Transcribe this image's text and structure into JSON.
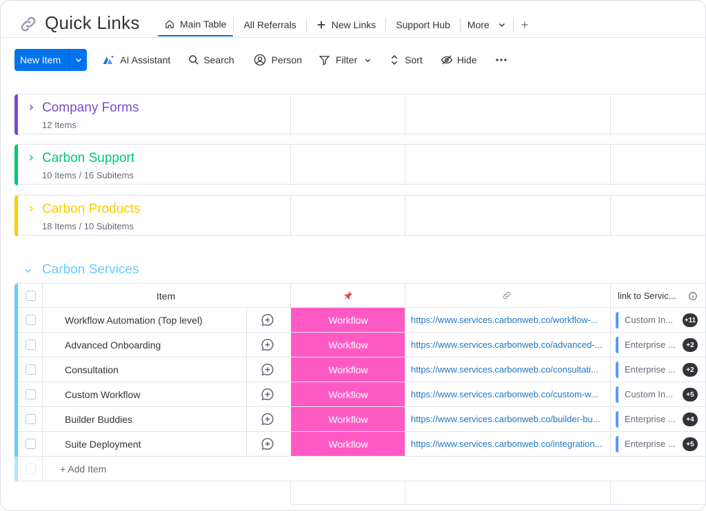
{
  "board": {
    "title": "Quick Links",
    "tabs": [
      {
        "label": "Main Table",
        "icon": "home-icon",
        "active": true
      },
      {
        "label": "All Referrals",
        "icon": "",
        "active": false
      },
      {
        "label": "New Links",
        "icon": "plus-icon",
        "active": false
      },
      {
        "label": "Support Hub",
        "icon": "",
        "active": false
      },
      {
        "label": "More",
        "icon": "chevron-down-icon",
        "active": false
      }
    ]
  },
  "toolbar": {
    "new_item": "New Item",
    "ai_assistant": "AI Assistant",
    "search": "Search",
    "person": "Person",
    "filter": "Filter",
    "sort": "Sort",
    "hide": "Hide"
  },
  "groups": [
    {
      "name": "Company Forms",
      "count": "12 Items",
      "color": "#784bd1"
    },
    {
      "name": "Carbon Support",
      "count": "10 Items / 16 Subitems",
      "color": "#00c875"
    },
    {
      "name": "Carbon Products",
      "count": "18 Items / 10 Subitems",
      "color": "#ffcb00"
    }
  ],
  "expanded_group": {
    "name": "Carbon Services",
    "color": "#66ccff",
    "columns": {
      "item": "Item",
      "service": "link to Servic..."
    },
    "rows": [
      {
        "name": "Workflow Automation (Top level)",
        "status": "Workflow",
        "link": "https://www.services.carbonweb.co/workflow-...",
        "service": "Custom In...",
        "badge": "+11"
      },
      {
        "name": "Advanced Onboarding",
        "status": "Workflow",
        "link": "https://www.services.carbonweb.co/advanced-...",
        "service": "Enterprise ...",
        "badge": "+2"
      },
      {
        "name": "Consultation",
        "status": "Workflow",
        "link": "https://www.services.carbonweb.co/consultati...",
        "service": "Enterprise ...",
        "badge": "+2"
      },
      {
        "name": "Custom Workflow",
        "status": "Workflow",
        "link": "https://www.services.carbonweb.co/custom-w...",
        "service": "Custom In...",
        "badge": "+5"
      },
      {
        "name": "Builder Buddies",
        "status": "Workflow",
        "link": "https://www.services.carbonweb.co/builder-bu...",
        "service": "Enterprise ...",
        "badge": "+4"
      },
      {
        "name": "Suite Deployment",
        "status": "Workflow",
        "link": "https://www.services.carbonweb.co/integration...",
        "service": "Enterprise ...",
        "badge": "+5"
      }
    ],
    "add_item": "+ Add Item"
  },
  "colors": {
    "accent": "#0073ea",
    "status_workflow": "#ff5ac4"
  }
}
